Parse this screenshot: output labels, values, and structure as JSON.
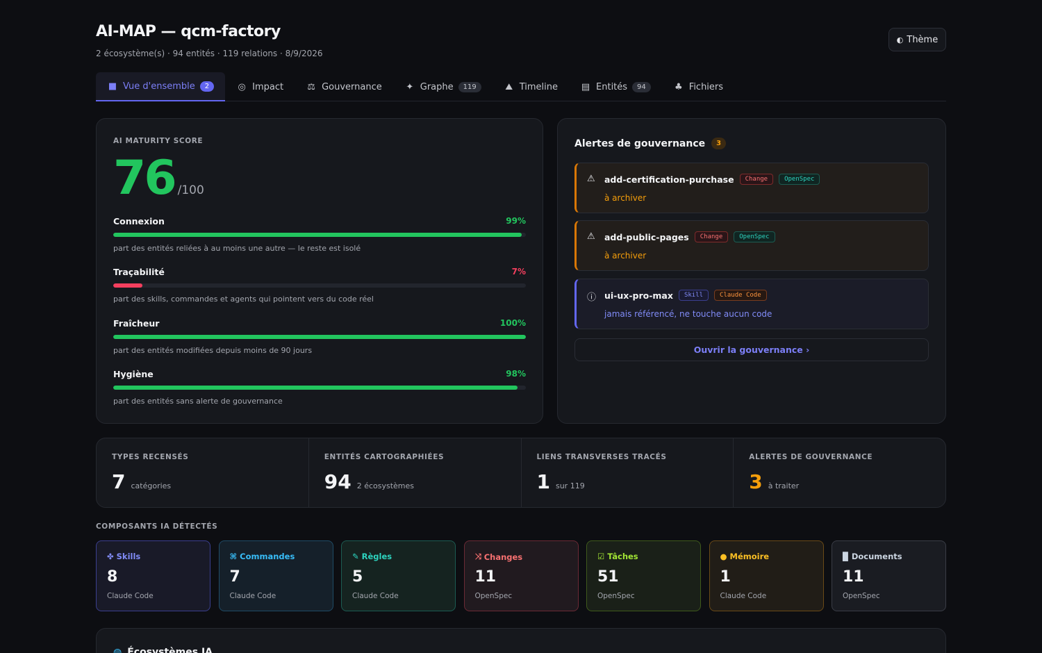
{
  "header": {
    "title": "AI-MAP — qcm-factory",
    "subtitle": "2 écosystème(s) · 94 entités · 119 relations · 8/9/2026",
    "theme_icon": "half-circle-icon",
    "theme_label": "Thème"
  },
  "tabs": [
    {
      "label": "Vue d'ensemble",
      "count": "2",
      "icon": "grid-icon",
      "glyph": "■",
      "active": true
    },
    {
      "label": "Impact",
      "count": "",
      "icon": "target-icon",
      "glyph": "◎"
    },
    {
      "label": "Gouvernance",
      "count": "",
      "icon": "scales-icon",
      "glyph": "⚖"
    },
    {
      "label": "Graphe",
      "count": "119",
      "icon": "graph-icon",
      "glyph": "✦"
    },
    {
      "label": "Timeline",
      "count": "",
      "icon": "mountain-icon",
      "glyph": "⛰"
    },
    {
      "label": "Entités",
      "count": "94",
      "icon": "index-card-icon",
      "glyph": "▤"
    },
    {
      "label": "Fichiers",
      "count": "",
      "icon": "tree-icon",
      "glyph": "♣"
    }
  ],
  "maturity": {
    "label": "AI MATURITY SCORE",
    "score": "76",
    "out_of": "/100",
    "metrics": [
      {
        "name": "Connexion",
        "pct": "99%",
        "value": 0.99,
        "color": "#22c55e",
        "desc": "part des entités reliées à au moins une autre — le reste est isolé"
      },
      {
        "name": "Traçabilité",
        "pct": "7%",
        "value": 0.07,
        "color": "#f43f5e",
        "desc": "part des skills, commandes et agents qui pointent vers du code réel"
      },
      {
        "name": "Fraîcheur",
        "pct": "100%",
        "value": 1.0,
        "color": "#22c55e",
        "desc": "part des entités modifiées depuis moins de 90 jours"
      },
      {
        "name": "Hygiène",
        "pct": "98%",
        "value": 0.98,
        "color": "#22c55e",
        "desc": "part des entités sans alerte de gouvernance"
      }
    ]
  },
  "alerts": {
    "title": "Alertes de gouvernance",
    "count": "3",
    "items": [
      {
        "kind": "warn",
        "icon": "warning-icon",
        "glyph": "⚠",
        "name": "add-certification-purchase",
        "tags": [
          {
            "label": "Change",
            "cls": "change"
          },
          {
            "label": "OpenSpec",
            "cls": "openspec"
          }
        ],
        "msg": "à archiver"
      },
      {
        "kind": "warn",
        "icon": "warning-icon",
        "glyph": "⚠",
        "name": "add-public-pages",
        "tags": [
          {
            "label": "Change",
            "cls": "change"
          },
          {
            "label": "OpenSpec",
            "cls": "openspec"
          }
        ],
        "msg": "à archiver"
      },
      {
        "kind": "info",
        "icon": "info-icon",
        "glyph": "ⓘ",
        "name": "ui-ux-pro-max",
        "tags": [
          {
            "label": "Skill",
            "cls": "skill"
          },
          {
            "label": "Claude Code",
            "cls": "claude"
          }
        ],
        "msg": "jamais référencé, ne touche aucun code"
      }
    ],
    "link": "Ouvrir la gouvernance ›"
  },
  "stats": [
    {
      "label": "TYPES RECENSÉS",
      "value": "7",
      "sub": "catégories",
      "color": "#f3f4f6"
    },
    {
      "label": "ENTITÉS CARTOGRAPHIÉES",
      "value": "94",
      "sub": "2 écosystèmes",
      "color": "#f3f4f6"
    },
    {
      "label": "LIENS TRANSVERSES TRACÉS",
      "value": "1",
      "sub": "sur 119",
      "color": "#f3f4f6"
    },
    {
      "label": "ALERTES DE GOUVERNANCE",
      "value": "3",
      "sub": "à traiter",
      "color": "#f59e0b"
    }
  ],
  "components": {
    "label": "COMPOSANTS IA DÉTECTÉS",
    "items": [
      {
        "name": "Skills",
        "value": "8",
        "source": "Claude Code",
        "icon": "sparkle-icon",
        "glyph": "✤",
        "color": "#818cf8",
        "border": "#3b3f8f",
        "bg": "#191a28"
      },
      {
        "name": "Commandes",
        "value": "7",
        "source": "Claude Code",
        "icon": "command-icon",
        "glyph": "⌘",
        "color": "#38bdf8",
        "border": "#1f4b66",
        "bg": "#15202a"
      },
      {
        "name": "Règles",
        "value": "5",
        "source": "Claude Code",
        "icon": "ruler-icon",
        "glyph": "✎",
        "color": "#2dd4bf",
        "border": "#1c5c52",
        "bg": "#152320"
      },
      {
        "name": "Changes",
        "value": "11",
        "source": "OpenSpec",
        "icon": "shuffle-icon",
        "glyph": "⤨",
        "color": "#f87171",
        "border": "#6b2a35",
        "bg": "#211a1f"
      },
      {
        "name": "Tâches",
        "value": "51",
        "source": "OpenSpec",
        "icon": "checkbox-icon",
        "glyph": "☑",
        "color": "#a3e635",
        "border": "#3f5a1c",
        "bg": "#1a2018"
      },
      {
        "name": "Mémoire",
        "value": "1",
        "source": "Claude Code",
        "icon": "brain-icon",
        "glyph": "●",
        "color": "#fbbf24",
        "border": "#6b4a17",
        "bg": "#211d17"
      },
      {
        "name": "Documents",
        "value": "11",
        "source": "OpenSpec",
        "icon": "document-icon",
        "glyph": "▉",
        "color": "#cbd5e1",
        "border": "#3a3d46",
        "bg": "#1a1c22"
      }
    ]
  },
  "ecosystems": {
    "title": "Écosystèmes IA",
    "icon": "globe-icon",
    "glyph": "◍"
  }
}
